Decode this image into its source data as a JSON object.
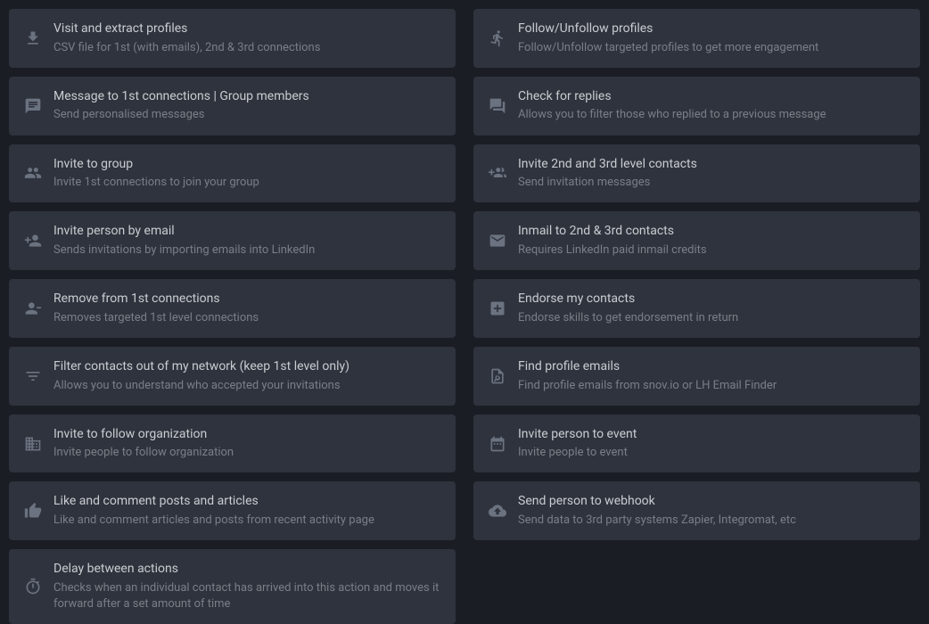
{
  "cards": [
    {
      "icon": "download-icon",
      "title": "Visit and extract profiles",
      "desc": "CSV file for 1st (with emails), 2nd & 3rd connections"
    },
    {
      "icon": "run-icon",
      "title": "Follow/Unfollow profiles",
      "desc": "Follow/Unfollow targeted profiles to get more engagement"
    },
    {
      "icon": "message-icon",
      "title": "Message to 1st connections | Group members",
      "desc": "Send personalised messages"
    },
    {
      "icon": "question-answer-icon",
      "title": "Check for replies",
      "desc": "Allows you to filter those who replied to a previous message"
    },
    {
      "icon": "group-icon",
      "title": "Invite to group",
      "desc": "Invite 1st connections to join your group"
    },
    {
      "icon": "person-plus-icon",
      "title": "Invite 2nd and 3rd level contacts",
      "desc": "Send invitation messages"
    },
    {
      "icon": "person-add-icon",
      "title": "Invite person by email",
      "desc": "Sends invitations by importing emails into LinkedIn"
    },
    {
      "icon": "mail-icon",
      "title": "Inmail to 2nd & 3rd contacts",
      "desc": "Requires LinkedIn paid inmail credits"
    },
    {
      "icon": "person-remove-icon",
      "title": "Remove from 1st connections",
      "desc": "Removes targeted 1st level connections"
    },
    {
      "icon": "add-box-icon",
      "title": "Endorse my contacts",
      "desc": "Endorse skills to get endorsement in return"
    },
    {
      "icon": "filter-icon",
      "title": "Filter contacts out of my network (keep 1st level only)",
      "desc": "Allows you to understand who accepted your invitations"
    },
    {
      "icon": "file-search-icon",
      "title": "Find profile emails",
      "desc": "Find profile emails from snov.io or LH Email Finder"
    },
    {
      "icon": "building-icon",
      "title": "Invite to follow organization",
      "desc": "Invite people to follow organization"
    },
    {
      "icon": "calendar-icon",
      "title": "Invite person to event",
      "desc": "Invite people to event"
    },
    {
      "icon": "thumb-up-icon",
      "title": "Like and comment posts and articles",
      "desc": "Like and comment articles and posts from recent activity page"
    },
    {
      "icon": "cloud-upload-icon",
      "title": "Send person to webhook",
      "desc": "Send data to 3rd party systems Zapier, Integromat, etc"
    },
    {
      "icon": "timer-icon",
      "title": "Delay between actions",
      "desc": "Checks when an individual contact has arrived into this action and moves it forward after a set amount of time"
    }
  ]
}
